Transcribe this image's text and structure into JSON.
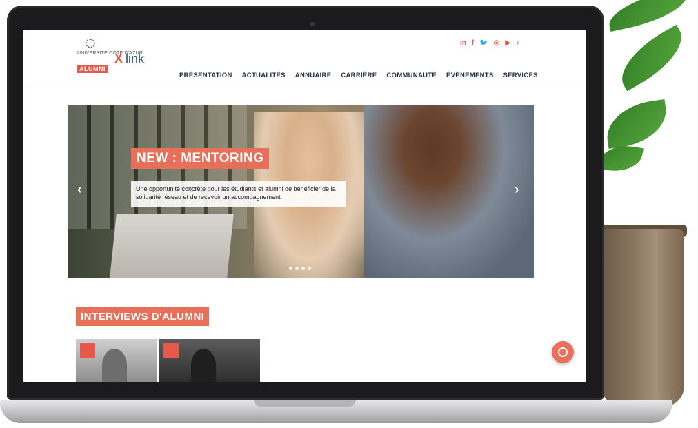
{
  "brand": {
    "university_text": "UNIVERSITÉ CÔTE D'AZUR",
    "alumni_badge": "ALUMNI",
    "x_mark": "X",
    "product_name": "link",
    "accent_color": "#e8584a",
    "navy_color": "#1f2f4a"
  },
  "socials": [
    {
      "icon": "linkedin-icon",
      "glyph": "in"
    },
    {
      "icon": "facebook-icon",
      "glyph": "f"
    },
    {
      "icon": "twitter-icon",
      "glyph": "🐦"
    },
    {
      "icon": "instagram-icon",
      "glyph": "◎"
    },
    {
      "icon": "youtube-icon",
      "glyph": "▶"
    },
    {
      "icon": "tiktok-icon",
      "glyph": "♪"
    }
  ],
  "nav": {
    "items": [
      "PRÉSENTATION",
      "ACTUALITÉS",
      "ANNUAIRE",
      "CARRIÈRE",
      "COMMUNAUTÉ",
      "ÉVÈNEMENTS",
      "SERVICES"
    ]
  },
  "hero": {
    "tag": "NEW : MENTORING",
    "description": "Une opportunité concrète pour les étudiants et alumni de bénéficier de la solidarité réseau et de recevoir un accompagnement.",
    "prev_glyph": "‹",
    "next_glyph": "›",
    "slide_count": 4
  },
  "interviews": {
    "title": "INTERVIEWS D'ALUMNI"
  }
}
